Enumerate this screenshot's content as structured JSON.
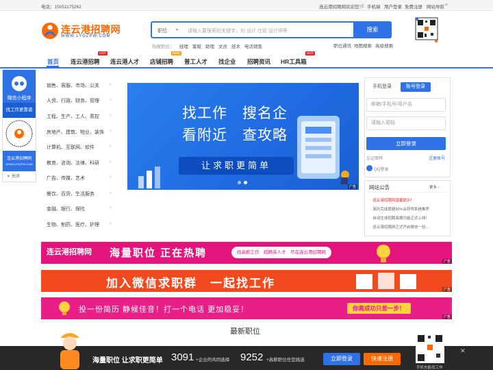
{
  "topbar": {
    "phone": "电话：15051175262",
    "welcome": "连云港招聘网欢迎您！",
    "mobile": "手机端",
    "login": "用户登录",
    "register": "免费注册",
    "nav": "网站导航",
    "menu_icon": "≡"
  },
  "logo": {
    "title": "连云港招聘网",
    "sub": "WWW.LYGZPW.COM"
  },
  "search": {
    "category": "职位",
    "placeholder": "请输入要搜索的关键字，如 设计 仓管 设计师等",
    "button": "搜索"
  },
  "hot": {
    "label": "热搜职位：",
    "items": [
      "经理",
      "客服",
      "助理",
      "文员",
      "技术",
      "电话销售"
    ]
  },
  "quick_links": [
    "职位通讯",
    "地图搜索",
    "高级搜索"
  ],
  "nav": {
    "items": [
      "首页",
      "连云港招聘",
      "连云港人才",
      "店铺招聘",
      "普工人才",
      "找企业",
      "招聘资讯",
      "HR工具箱"
    ],
    "tags": {
      "hot": "HOT",
      "new": "NEW"
    }
  },
  "categories": [
    "销售、客服、市场、公关",
    "人资、行政、财务、管理",
    "工程、生产、工人、质控",
    "房地产、建筑、物业、装饰",
    "计算机、互联网、软件",
    "教育、咨询、法律、科研",
    "广告、传媒、艺术",
    "餐饮、百货、生活服务",
    "金融、银行、保险",
    "生物、制药、医疗、护理"
  ],
  "left_widget": {
    "label1": "微信小程序",
    "label2": "找工作更靠谱",
    "brand": "连云港招聘网",
    "site": "WWW.LYGZPW.COM",
    "close": "关闭"
  },
  "banner": {
    "line1": "找工作　搜名企",
    "line2": "看附近　查攻略",
    "pill": "让求职更简单",
    "ad": "广告"
  },
  "login": {
    "tab_mobile": "手机登录",
    "tab_account": "账号登录",
    "user_ph": "邮箱/手机号/用户名",
    "pwd_ph": "请输入密码",
    "btn": "立即登录",
    "forgot": "忘记密码",
    "register": "注册账号",
    "qq": "QQ登录"
  },
  "notice": {
    "title": "网站公告",
    "more": "更多 ›",
    "items": [
      "连云港招聘网温馨提示！",
      "简历完成度超90%会获得系统推荐",
      "自动生成招聘海报功能正式上线！",
      "连云港招聘网正式开启微信一扫...",
      ""
    ]
  },
  "strips": [
    {
      "logo": "连云港招聘网",
      "text": "海量职位 正在热聘",
      "sub": "找高薪工作　招精英人才　尽在连云港招聘网",
      "ad": "广告"
    },
    {
      "text": "加入微信求职群　一起找工作",
      "ad": "广告"
    },
    {
      "text": "投一份简历 静候佳音！打一个电话 更加稳妥！",
      "badge": "你离成功只差一步！",
      "ad": "广告"
    }
  ],
  "latest": "最新职位",
  "footer": {
    "slogan": "海量职位 让求职更简单",
    "jobs": "3091",
    "jobs_label": "+企业的共同选择",
    "resumes": "9252",
    "resumes_label": "+高薪职位任您挑选",
    "login": "立即登录",
    "register": "快速注册",
    "qr_caption": "手机也能找工作",
    "close": "✕"
  },
  "colors": {
    "primary": "#2f72e6",
    "orange": "#ff6a00",
    "hot": "#e8262d"
  }
}
